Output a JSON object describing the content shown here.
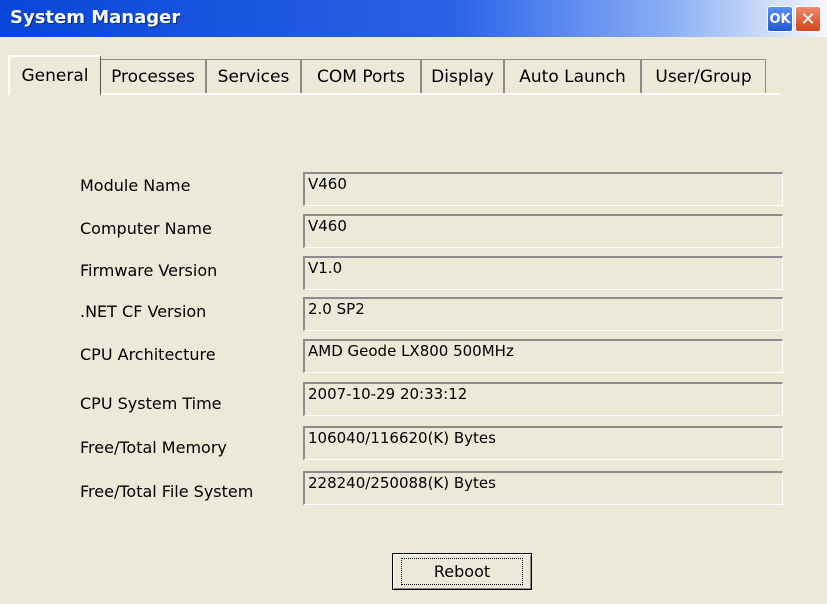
{
  "window": {
    "title": "System Manager",
    "ok_label": "OK",
    "close_label": "✕"
  },
  "tabs": [
    {
      "label": "General",
      "active": true
    },
    {
      "label": "Processes",
      "active": false
    },
    {
      "label": "Services",
      "active": false
    },
    {
      "label": "COM Ports",
      "active": false
    },
    {
      "label": "Display",
      "active": false
    },
    {
      "label": "Auto Launch",
      "active": false
    },
    {
      "label": "User/Group",
      "active": false
    }
  ],
  "fields": [
    {
      "label": "Module Name",
      "value": "V460"
    },
    {
      "label": "Computer Name",
      "value": "V460"
    },
    {
      "label": "Firmware Version",
      "value": "V1.0"
    },
    {
      "label": ".NET CF Version",
      "value": "2.0 SP2"
    },
    {
      "label": "CPU Architecture",
      "value": "AMD Geode LX800 500MHz"
    },
    {
      "label": "CPU System Time",
      "value": "2007-10-29 20:33:12"
    },
    {
      "label": "Free/Total Memory",
      "value": "106040/116620(K) Bytes"
    },
    {
      "label": "Free/Total File System",
      "value": "228240/250088(K) Bytes"
    }
  ],
  "buttons": {
    "reboot_label": "Reboot"
  }
}
